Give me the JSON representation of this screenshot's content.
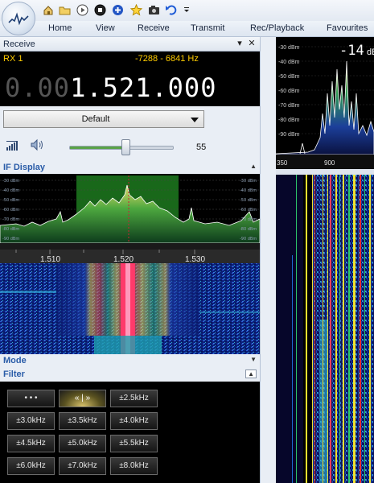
{
  "quick_access": {
    "icons": [
      "home-icon",
      "folder-icon",
      "play-icon",
      "stop-icon",
      "add-icon",
      "favourite-star-icon",
      "camera-icon",
      "undo-icon",
      "dropdown-icon"
    ]
  },
  "menu": [
    "Home",
    "View",
    "Receive",
    "Transmit",
    "Rec/Playback",
    "Favourites"
  ],
  "receive_panel": {
    "title": "Receive",
    "rx_label": "RX 1",
    "range": "-7288 - 6841 Hz",
    "freq_dim": "0.00",
    "freq_main": "1.521.000",
    "mode_preset": "Default",
    "volume": "55",
    "volume_fraction": 0.55
  },
  "if_display": {
    "title": "IF Display",
    "db_labels": [
      "-30 dBm",
      "-40 dBm",
      "-50 dBm",
      "-60 dBm",
      "-70 dBm",
      "-80 dBm",
      "-90 dBm"
    ],
    "freq_ticks": [
      "1.510",
      "1.520",
      "1.530"
    ]
  },
  "mode_section": {
    "title": "Mode"
  },
  "filter_section": {
    "title": "Filter",
    "buttons": [
      [
        "• • •",
        "« | »",
        "±2.5kHz"
      ],
      [
        "±3.0kHz",
        "±3.5kHz",
        "±4.0kHz"
      ],
      [
        "±4.5kHz",
        "±5.0kHz",
        "±5.5kHz"
      ],
      [
        "±6.0kHz",
        "±7.0kHz",
        "±8.0kHz"
      ]
    ],
    "selected": "« | »"
  },
  "main_spectrum": {
    "db_labels": [
      "-30 dBm",
      "-40 dBm",
      "-50 dBm",
      "-60 dBm",
      "-70 dBm",
      "-80 dBm",
      "-90 dBm"
    ],
    "level_readout": "-14",
    "level_unit": "dB",
    "freq_ticks": [
      "350",
      "900"
    ]
  },
  "colors": {
    "accent": "#2a5ca8",
    "rx_text": "#ffcc00",
    "spectrum_fill": "#2e8a3a"
  }
}
